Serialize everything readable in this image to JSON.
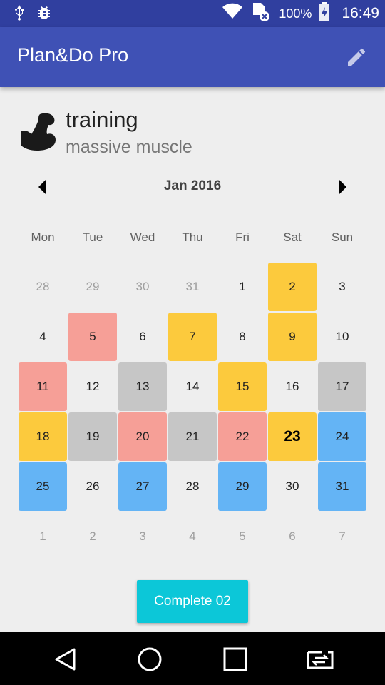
{
  "status_bar": {
    "battery_percent": "100%",
    "time": "16:49",
    "icons": [
      "usb-icon",
      "bug-icon",
      "wifi-icon",
      "sim-error-icon",
      "battery-charging-icon"
    ]
  },
  "app_bar": {
    "title": "Plan&Do Pro",
    "edit_icon": "pencil-icon"
  },
  "habit": {
    "icon": "flexed-biceps-icon",
    "title": "training",
    "subtitle": "massive muscle"
  },
  "calendar": {
    "month_label": "Jan 2016",
    "prev_icon": "triangle-left-icon",
    "next_icon": "triangle-right-icon",
    "weekdays": [
      "Mon",
      "Tue",
      "Wed",
      "Thu",
      "Fri",
      "Sat",
      "Sun"
    ],
    "colors": {
      "yellow": "#fcca3d",
      "red": "#f69f97",
      "gray": "#c6c6c6",
      "blue": "#64b4f5"
    },
    "weeks": [
      [
        {
          "day": "28",
          "in_month": false,
          "mark": null
        },
        {
          "day": "29",
          "in_month": false,
          "mark": null
        },
        {
          "day": "30",
          "in_month": false,
          "mark": null
        },
        {
          "day": "31",
          "in_month": false,
          "mark": null
        },
        {
          "day": "1",
          "in_month": true,
          "mark": null
        },
        {
          "day": "2",
          "in_month": true,
          "mark": "yellow"
        },
        {
          "day": "3",
          "in_month": true,
          "mark": null
        }
      ],
      [
        {
          "day": "4",
          "in_month": true,
          "mark": null
        },
        {
          "day": "5",
          "in_month": true,
          "mark": "red"
        },
        {
          "day": "6",
          "in_month": true,
          "mark": null
        },
        {
          "day": "7",
          "in_month": true,
          "mark": "yellow"
        },
        {
          "day": "8",
          "in_month": true,
          "mark": null
        },
        {
          "day": "9",
          "in_month": true,
          "mark": "yellow"
        },
        {
          "day": "10",
          "in_month": true,
          "mark": null
        }
      ],
      [
        {
          "day": "11",
          "in_month": true,
          "mark": "red"
        },
        {
          "day": "12",
          "in_month": true,
          "mark": null
        },
        {
          "day": "13",
          "in_month": true,
          "mark": "gray"
        },
        {
          "day": "14",
          "in_month": true,
          "mark": null
        },
        {
          "day": "15",
          "in_month": true,
          "mark": "yellow"
        },
        {
          "day": "16",
          "in_month": true,
          "mark": null
        },
        {
          "day": "17",
          "in_month": true,
          "mark": "gray"
        }
      ],
      [
        {
          "day": "18",
          "in_month": true,
          "mark": "yellow"
        },
        {
          "day": "19",
          "in_month": true,
          "mark": "gray"
        },
        {
          "day": "20",
          "in_month": true,
          "mark": "red"
        },
        {
          "day": "21",
          "in_month": true,
          "mark": "gray"
        },
        {
          "day": "22",
          "in_month": true,
          "mark": "red"
        },
        {
          "day": "23",
          "in_month": true,
          "mark": "yellow",
          "today": true
        },
        {
          "day": "24",
          "in_month": true,
          "mark": "blue"
        }
      ],
      [
        {
          "day": "25",
          "in_month": true,
          "mark": "blue"
        },
        {
          "day": "26",
          "in_month": true,
          "mark": null
        },
        {
          "day": "27",
          "in_month": true,
          "mark": "blue"
        },
        {
          "day": "28",
          "in_month": true,
          "mark": null
        },
        {
          "day": "29",
          "in_month": true,
          "mark": "blue"
        },
        {
          "day": "30",
          "in_month": true,
          "mark": null
        },
        {
          "day": "31",
          "in_month": true,
          "mark": "blue"
        }
      ],
      [
        {
          "day": "1",
          "in_month": false,
          "mark": null
        },
        {
          "day": "2",
          "in_month": false,
          "mark": null
        },
        {
          "day": "3",
          "in_month": false,
          "mark": null
        },
        {
          "day": "4",
          "in_month": false,
          "mark": null
        },
        {
          "day": "5",
          "in_month": false,
          "mark": null
        },
        {
          "day": "6",
          "in_month": false,
          "mark": null
        },
        {
          "day": "7",
          "in_month": false,
          "mark": null
        }
      ]
    ]
  },
  "complete_button": {
    "label": "Complete 02",
    "color": "#0cc7d8"
  },
  "nav_bar": {
    "icons": [
      "back-icon",
      "home-icon",
      "recents-icon",
      "switch-app-icon"
    ]
  }
}
